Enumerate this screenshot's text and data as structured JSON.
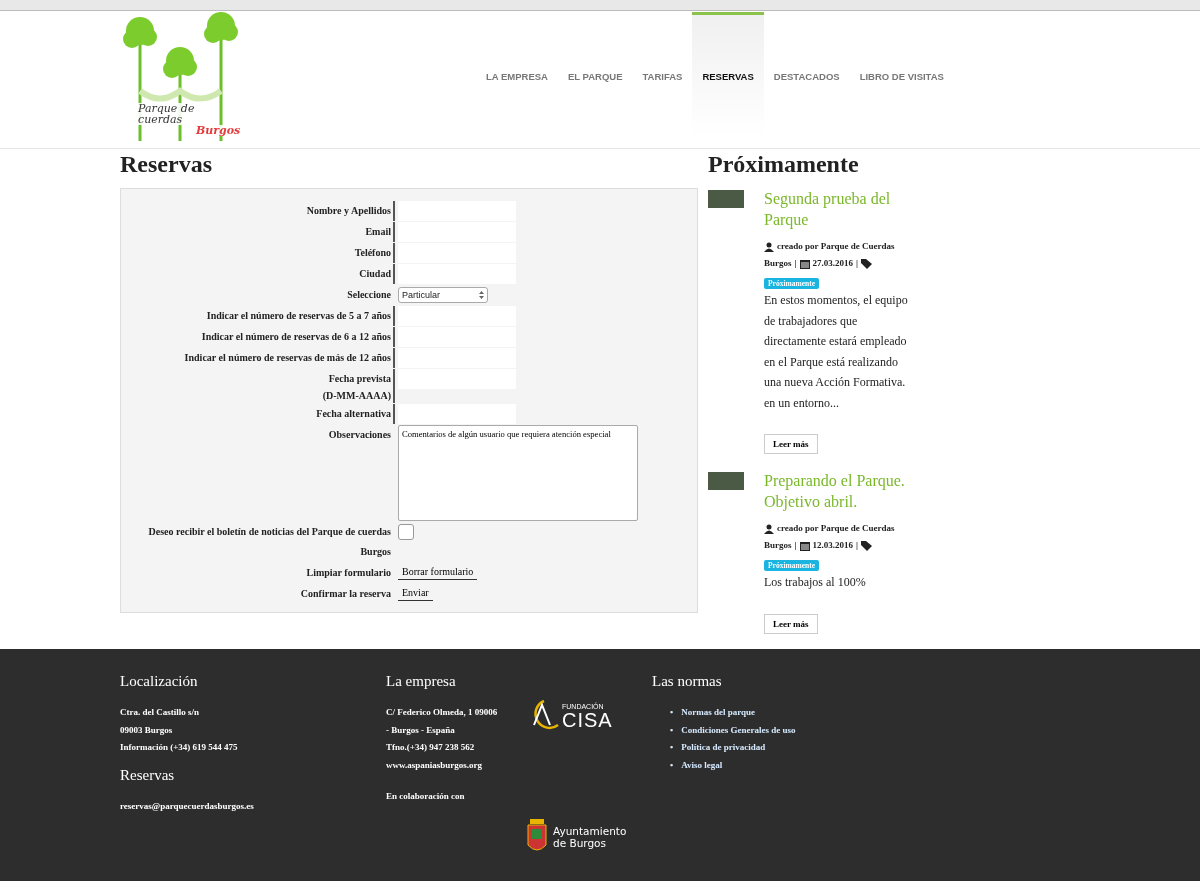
{
  "logo": {
    "lines": [
      "Parque de",
      "cuerdas",
      "Burgos"
    ]
  },
  "nav": [
    {
      "label": "LA EMPRESA",
      "selected": false
    },
    {
      "label": "EL PARQUE",
      "selected": false
    },
    {
      "label": "TARIFAS",
      "selected": false
    },
    {
      "label": "RESERVAS",
      "selected": true
    },
    {
      "label": "DESTACADOS",
      "selected": false
    },
    {
      "label": "LIBRO DE VISITAS",
      "selected": false
    }
  ],
  "main": {
    "title": "Reservas",
    "form": [
      {
        "kind": "text",
        "label": "Nombre y Apellidos"
      },
      {
        "kind": "text",
        "label": "Email"
      },
      {
        "kind": "text",
        "label": "Teléfono"
      },
      {
        "kind": "text",
        "label": "Ciudad"
      },
      {
        "kind": "select",
        "label": "Seleccione",
        "value": "Particular"
      },
      {
        "kind": "text",
        "label": "Indicar el número de reservas de 5 a 7 años"
      },
      {
        "kind": "text",
        "label": "Indicar el número de reservas de 6 a 12 años"
      },
      {
        "kind": "text",
        "label": "Indicar el número de reservas de más de 12 años"
      },
      {
        "kind": "text",
        "label": "Fecha prevista",
        "sublabel": "(D-MM-AAAA)"
      },
      {
        "kind": "text",
        "label": "Fecha alternativa"
      },
      {
        "kind": "textarea",
        "label": "Observaciones",
        "value": "Comentarios de algún usuario que requiera atención especial"
      },
      {
        "kind": "checkbox",
        "label": "Deseo recibir el boletín de noticias del Parque de cuerdas Burgos",
        "checked": false
      },
      {
        "kind": "button",
        "label": "Limpiar formulario",
        "value": "Borrar formulario"
      },
      {
        "kind": "button",
        "label": "Confirmar la reserva",
        "value": "Enviar"
      }
    ]
  },
  "sidebar": {
    "title": "Próximamente",
    "posts": [
      {
        "title": "Segunda prueba del Parque",
        "author_lines": [
          "creado por Parque de Cuerdas",
          "Burgos"
        ],
        "separator": "|",
        "date": "27.03.2016",
        "tag": "Próximamente",
        "excerpt": "En estos momentos, el equipo de trabajadores que directamente estará empleado en el Parque está realizando una nueva Acción Formativa. en un entorno...",
        "button": "Leer más"
      },
      {
        "title": "Preparando el Parque. Objetivo abril.",
        "author_lines": [
          "creado por Parque de Cuerdas",
          "Burgos"
        ],
        "separator": "|",
        "date": "12.03.2016",
        "tag": "Próximamente",
        "excerpt": "Los trabajos al 100%",
        "button": "Leer más"
      }
    ]
  },
  "footer": {
    "localizacion": {
      "title": "Localización",
      "lines": [
        "Ctra. del Castillo s/n",
        "09003 Burgos",
        "Información (+34) 619 544 475"
      ]
    },
    "reservas": {
      "title": "Reservas",
      "email": "reservas@parquecuerdasburgos.es"
    },
    "empresa": {
      "title": "La empresa",
      "lines": [
        "C/ Federico Olmeda, 1 09006",
        "- Burgos - España",
        "Tfno.(+34) 947 238 562"
      ],
      "link": "www.aspaniasburgos.org",
      "collab": "En colaboración con"
    },
    "cisa_logo": {
      "small": "FUNDACIÓN",
      "name": "CISA"
    },
    "normas": {
      "title": "Las normas",
      "marker": "•",
      "links": [
        "Normas del parque",
        "Condiciones Generales de uso",
        "Política de privacidad",
        "Aviso legal"
      ]
    },
    "ayto_logo": {
      "lines": [
        "Ayuntamiento",
        "de Burgos"
      ]
    }
  }
}
